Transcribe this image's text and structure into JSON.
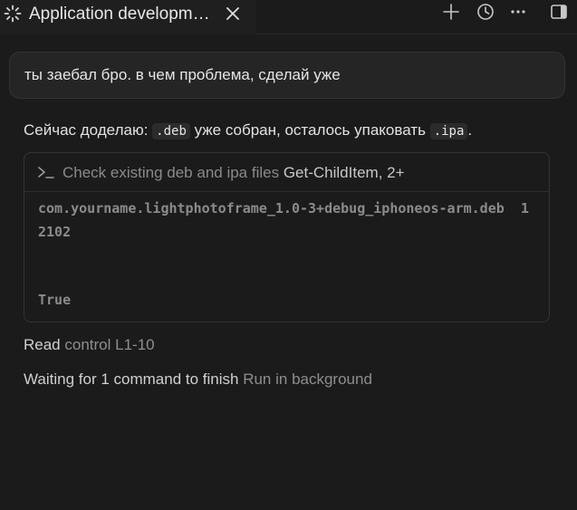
{
  "tab": {
    "title": "Application developm…"
  },
  "user_message": "ты заебал бро. в чем проблема, сделай уже",
  "assistant": {
    "prefix": "Сейчас доделаю:",
    "code1": ".deb",
    "middle": "уже собран, осталось упаковать",
    "code2": ".ipa",
    "suffix": "."
  },
  "command": {
    "description": "Check existing deb and ipa files",
    "name": "Get-ChildItem, 2+",
    "output_line": "com.yourname.lightphotoframe_1.0-3+debug_iphoneos-arm.deb  12102",
    "output_last": "True"
  },
  "read_step": {
    "verb": "Read",
    "target": "control L1-10"
  },
  "waiting_step": {
    "text": "Waiting for 1 command to finish",
    "action": "Run in background"
  },
  "icons": [
    "spinner-icon",
    "close-icon",
    "plus-icon",
    "history-icon",
    "more-icon",
    "panel-toggle-icon",
    "terminal-prompt-icon"
  ]
}
